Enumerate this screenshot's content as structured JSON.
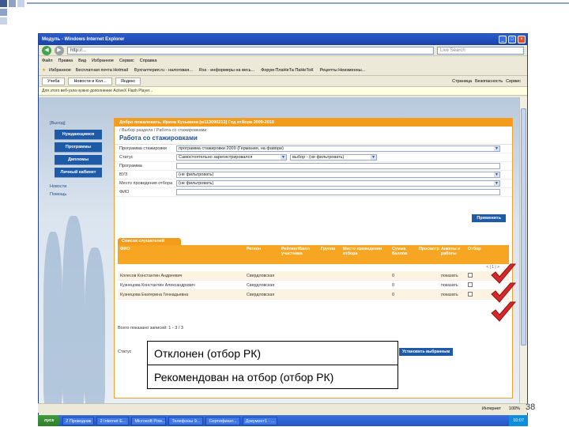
{
  "window": {
    "title": "Модуль - Windows Internet Explorer",
    "url": "http://...",
    "search_placeholder": "Live Search",
    "menu": [
      "Файл",
      "Правка",
      "Вид",
      "Избранное",
      "Сервис",
      "Справка"
    ],
    "favorites_label": "Избранное",
    "favorites": [
      "Бесплатная почта Hotmail",
      "Бухгалтерия.ru - налоговая...",
      "Rss - информеры на весь...",
      "Форум ПлаНеТа ПаНеТоК",
      "Рецепты Неизменны..."
    ],
    "tabs": [
      "Учеба",
      "Новости и Кол...",
      "Яндекс"
    ],
    "tools": [
      "Страница",
      "Безопасность",
      "Сервис"
    ],
    "infobar": "Для этого веб-узла нужно дополнение ActiveX Flash Player..."
  },
  "sidebar": {
    "exit": "Выход",
    "nav": [
      "Нуждающимся",
      "Программы",
      "Дипломы",
      "Личный кабинет"
    ],
    "links": [
      "Новости",
      "Помощь"
    ]
  },
  "main": {
    "userbar": "Добро пожаловать, Ирина Кузьмина [м113090213] Год отбора 2009-2010",
    "breadcrumb": "/ Выбор раздела / Работа со стажировками",
    "title": "Работа со стажировками",
    "filters": [
      {
        "label": "Программа стажировки",
        "value": "программа стажировки 2009 (Германия, на фавори)"
      },
      {
        "label": "Статус",
        "value": "Самостоятельно зарегистрировался",
        "extra": "выбор - (не фильтровать)"
      },
      {
        "label": "Программа",
        "value": ""
      },
      {
        "label": "ВУЗ",
        "value": "(не фильтровать)"
      },
      {
        "label": "Место проведения отбора",
        "value": "(не фильтровать)"
      },
      {
        "label": "ФИО",
        "value": ""
      }
    ],
    "apply_label": "Применить",
    "list_title": "Список слушателей",
    "columns": [
      "ФИО",
      "Регион",
      "Рейтинг/Балл участника",
      "Группа",
      "Место проведения отбора",
      "Сумма баллов",
      "Просмотр",
      "Анкеты и работы",
      "Отбор"
    ],
    "pager": "< | 1 | >",
    "rows": [
      {
        "name": "Колесов Константин Андреевич",
        "region": "Свердловская",
        "score": "0",
        "action": "показать"
      },
      {
        "name": "Кузнецова Константин Александрович",
        "region": "Свердловская",
        "score": "0",
        "action": "показать"
      },
      {
        "name": "Кузнецова Екатерина Геннадьевна",
        "region": "Свердловская",
        "score": "0",
        "action": "показать"
      }
    ],
    "shown_text": "Всего показано записей: 1 - 3 / 3",
    "status_label": "Статус",
    "set_button": "Установить выбранным"
  },
  "callout": {
    "line1": "Отклонен (отбор РК)",
    "line2": "Рекомендован на отбор (отбор РК)"
  },
  "statusbar": {
    "zone": "Интернет",
    "zoom": "100%"
  },
  "taskbar": {
    "start": "пуск",
    "items": [
      "2 Проводник",
      "2 Internet E...",
      "Microsoft Pow...",
      "Телефоны 9...",
      "Сертификат...",
      "Документ1 - ..."
    ],
    "clock": "10:07"
  },
  "page_number": "38",
  "accent": "#f39c1b",
  "brand": "#1f5aa7"
}
